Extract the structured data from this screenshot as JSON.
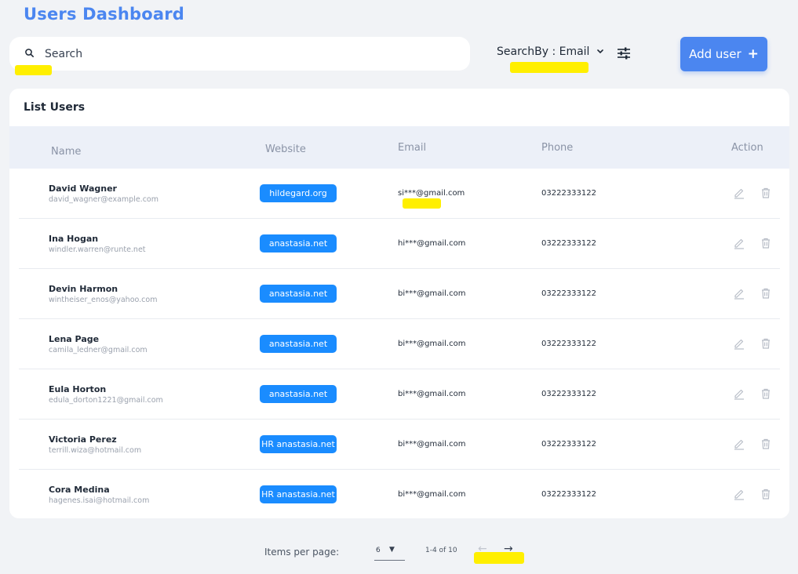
{
  "header": {
    "title": "Users Dashboard"
  },
  "toolbar": {
    "search_placeholder": "Search",
    "search_by_label": "SearchBy : Email",
    "add_user_label": "Add user",
    "add_user_icon": "+"
  },
  "list": {
    "title": "List Users",
    "columns": [
      "Name",
      "Website",
      "Email",
      "Phone",
      "Action"
    ],
    "rows": [
      {
        "name": "David Wagner",
        "email_sub": "david_wagner@example.com",
        "website": "hildegard.org",
        "email": "si***@gmail.com",
        "phone": "03222333122"
      },
      {
        "name": "Ina Hogan",
        "email_sub": "windler.warren@runte.net",
        "website": "anastasia.net",
        "email": "hi***@gmail.com",
        "phone": "03222333122"
      },
      {
        "name": "Devin Harmon",
        "email_sub": "wintheiser_enos@yahoo.com",
        "website": "anastasia.net",
        "email": "bi***@gmail.com",
        "phone": "03222333122"
      },
      {
        "name": "Lena Page",
        "email_sub": "camila_ledner@gmail.com",
        "website": "anastasia.net",
        "email": "bi***@gmail.com",
        "phone": "03222333122"
      },
      {
        "name": "Eula Horton",
        "email_sub": "edula_dorton1221@gmail.com",
        "website": "anastasia.net",
        "email": "bi***@gmail.com",
        "phone": "03222333122"
      },
      {
        "name": "Victoria Perez",
        "email_sub": "terrill.wiza@hotmail.com",
        "website": "HR anastasia.net",
        "email": "bi***@gmail.com",
        "phone": "03222333122"
      },
      {
        "name": "Cora Medina",
        "email_sub": "hagenes.isai@hotmail.com",
        "website": "HR anastasia.net",
        "email": "bi***@gmail.com",
        "phone": "03222333122"
      }
    ]
  },
  "pagination": {
    "items_per_page_label": "Items per page:",
    "per_page_value": "6",
    "range_text": "1-4 of 10",
    "prev_icon": "←",
    "next_icon": "→"
  },
  "colors": {
    "accent": "#4b86f0",
    "badge": "#1a8cff",
    "highlight": "#ffef00",
    "table_header_bg": "#ecf0f8"
  }
}
